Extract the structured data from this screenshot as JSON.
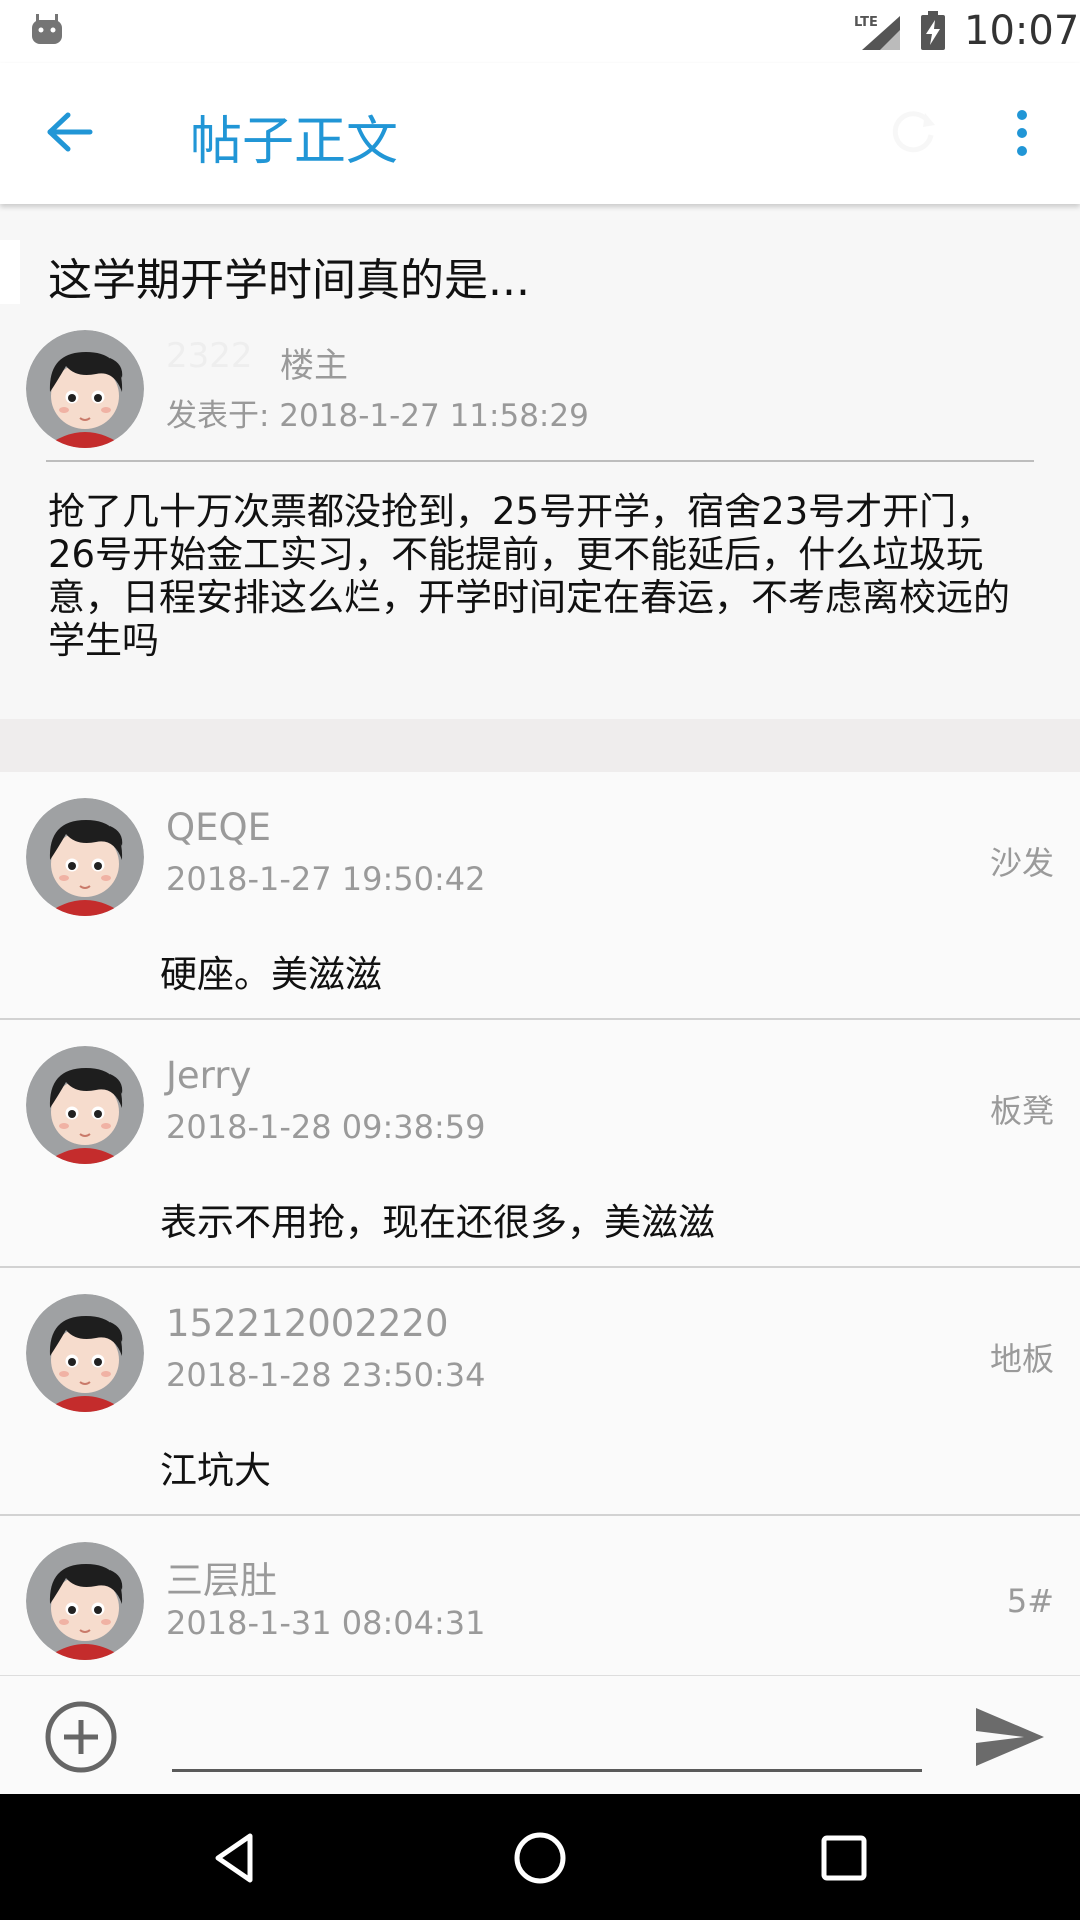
{
  "status_bar": {
    "time": "10:07",
    "network": "LTE"
  },
  "app_bar": {
    "title": "帖子正文",
    "back_icon": "arrow-left-icon",
    "refresh_icon": "refresh-icon",
    "menu_icon": "more-vert-icon",
    "accent": "#2196d6"
  },
  "post": {
    "title": "这学期开学时间真的是...",
    "author": "2322",
    "owner_tag": "楼主",
    "posted_at": "发表于: 2018-1-27 11:58:29",
    "content": "抢了几十万次票都没抢到，25号开学，宿舍23号才开门，26号开始金工实习，不能提前，更不能延后，什么垃圾玩意，日程安排这么烂，开学时间定在春运，不考虑离校远的学生吗"
  },
  "replies": [
    {
      "name": "QEQE",
      "time": "2018-1-27 19:50:42",
      "floor": "沙发",
      "text": "硬座。美滋滋"
    },
    {
      "name": "Jerry",
      "time": "2018-1-28 09:38:59",
      "floor": "板凳",
      "text": "表示不用抢，现在还很多，美滋滋"
    },
    {
      "name": "152212002220",
      "time": "2018-1-28 23:50:34",
      "floor": "地板",
      "text": "江坑大"
    },
    {
      "name": "三层肚",
      "time": "2018-1-31 08:04:31",
      "floor": "5#",
      "text": ""
    }
  ],
  "input": {
    "value": "",
    "placeholder": ""
  }
}
